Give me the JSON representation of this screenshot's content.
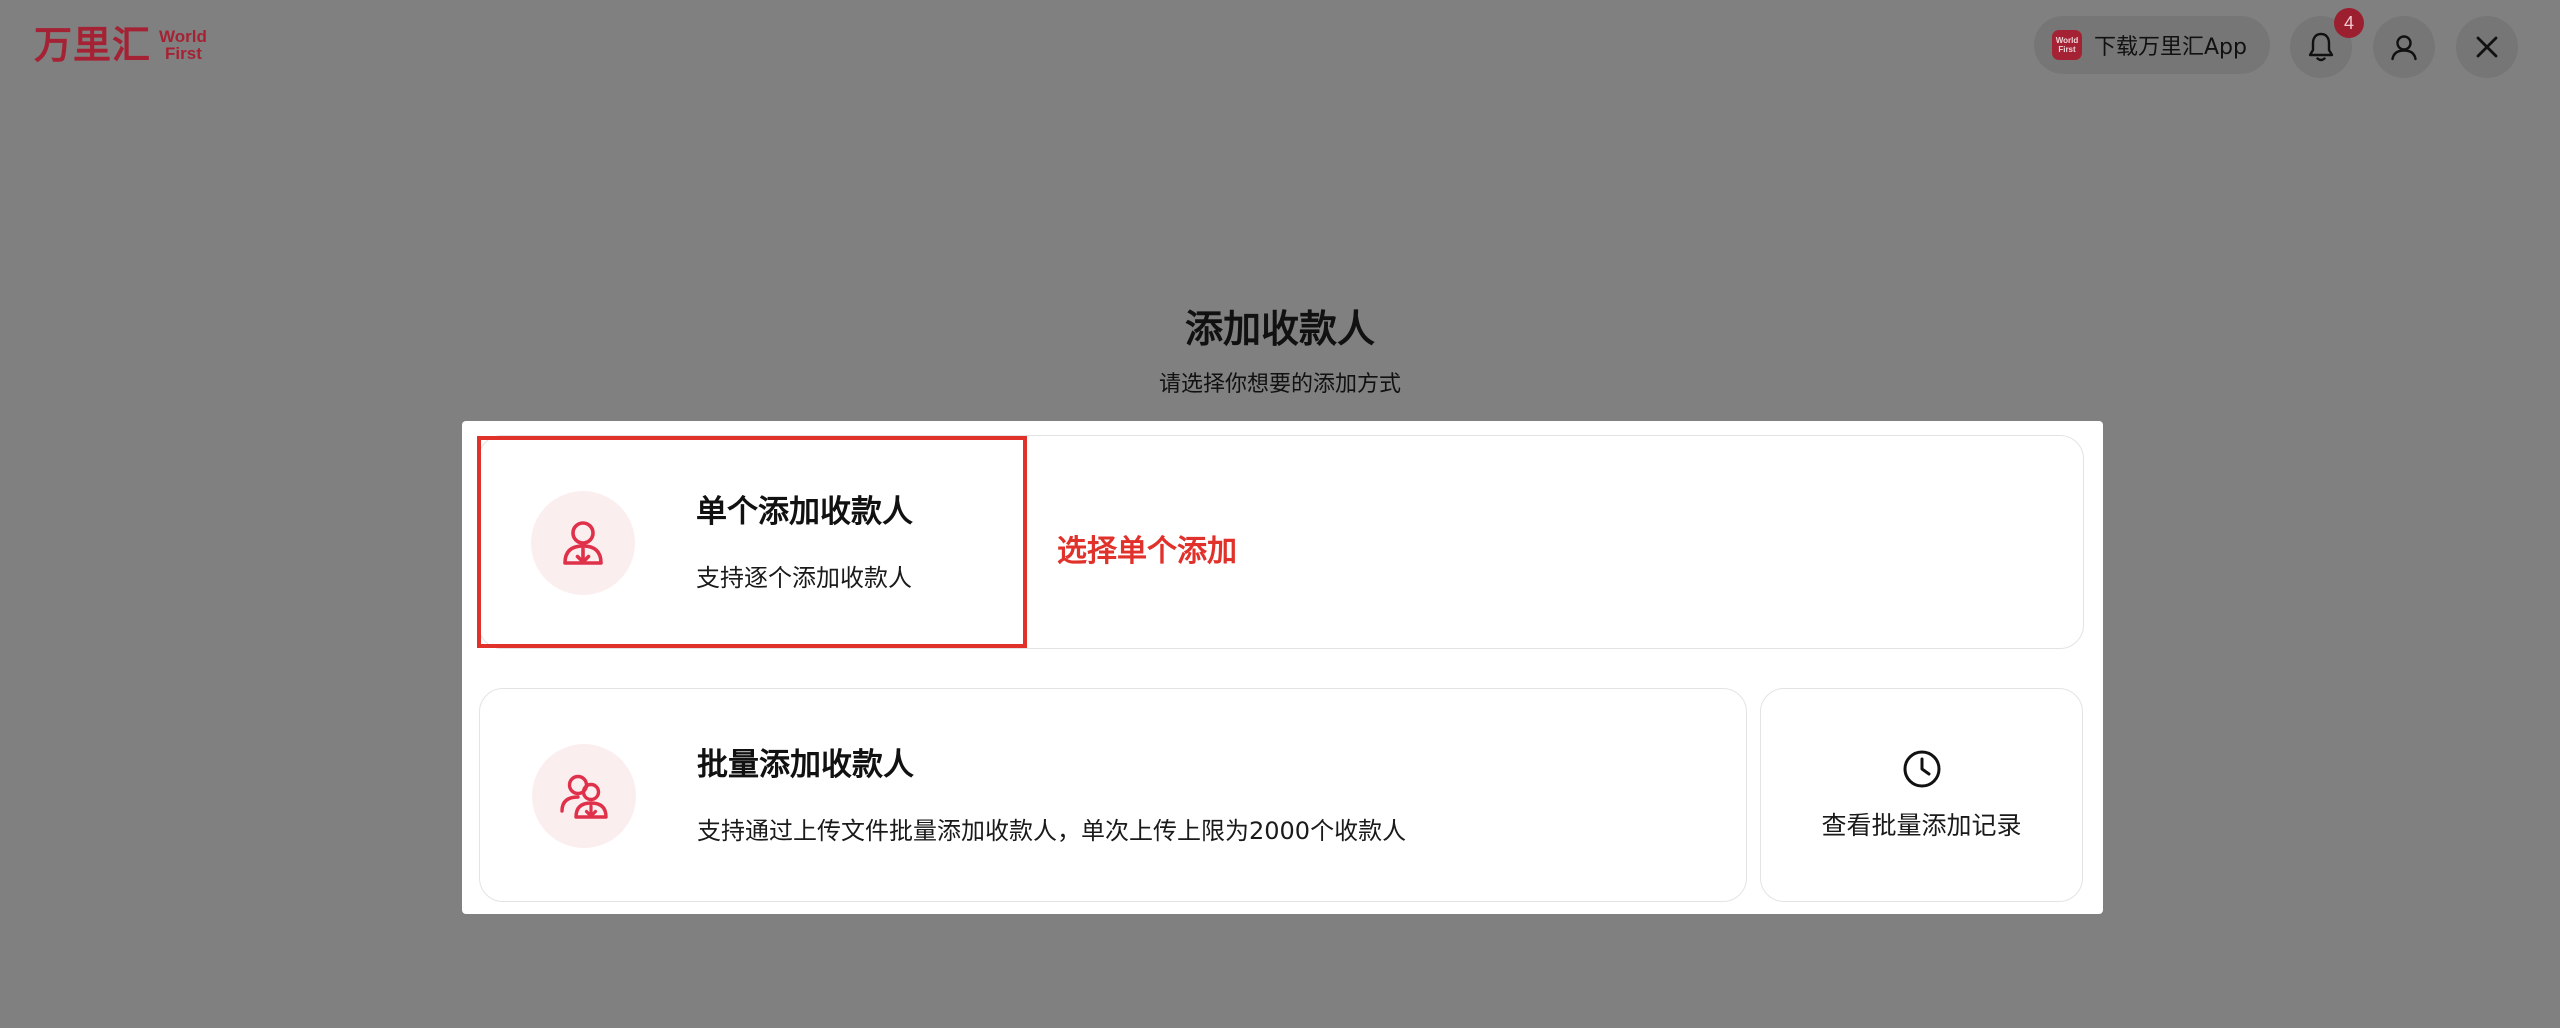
{
  "header": {
    "logo_cn": "万里汇",
    "logo_en_line1": "World",
    "logo_en_line2": "First",
    "app_badge_line1": "World",
    "app_badge_line2": "First",
    "download_app_label": "下载万里汇App",
    "notification_count": "4",
    "icons": {
      "bell": "bell-icon",
      "user": "user-icon",
      "close": "close-icon"
    }
  },
  "page": {
    "title": "添加收款人",
    "subtitle": "请选择你想要的添加方式"
  },
  "options": {
    "single": {
      "title": "单个添加收款人",
      "description": "支持逐个添加收款人",
      "icon": "user-add-icon"
    },
    "batch": {
      "title": "批量添加收款人",
      "description": "支持通过上传文件批量添加收款人，单次上传上限为2000个收款人",
      "icon": "users-add-icon"
    },
    "history": {
      "label": "查看批量添加记录",
      "icon": "clock-icon"
    }
  },
  "annotation": {
    "text": "选择单个添加",
    "color": "#e0312b"
  },
  "colors": {
    "brand": "#a52234",
    "accent_icon": "#e0314b",
    "overlay": "#808080",
    "highlight": "#e0312b"
  }
}
